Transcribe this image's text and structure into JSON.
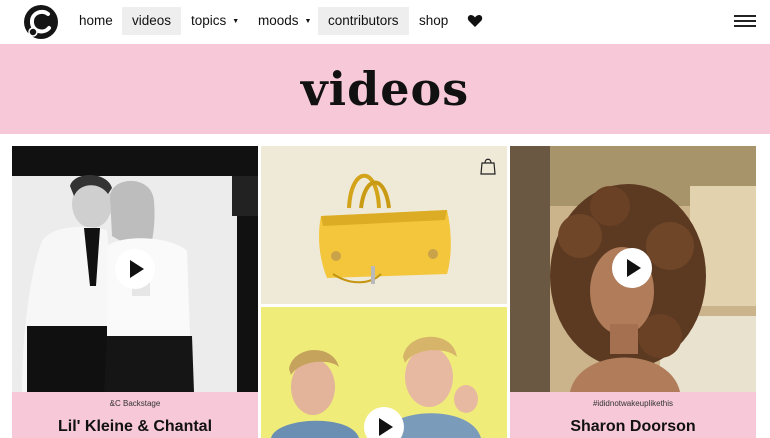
{
  "nav": {
    "items": [
      {
        "label": "home"
      },
      {
        "label": "videos"
      },
      {
        "label": "topics"
      },
      {
        "label": "moods"
      },
      {
        "label": "contributors"
      },
      {
        "label": "shop"
      }
    ],
    "caret": "▼",
    "icons": {
      "logo": "andc-logo",
      "heart": "heart-icon",
      "menu": "hamburger-menu-icon"
    }
  },
  "hero": {
    "title": "videos"
  },
  "cards": [
    {
      "tag": "&C Backstage",
      "title": "Lil' Kleine & Chantal",
      "type": "video"
    },
    {
      "type": "product",
      "icon": "shopping-bag-icon"
    },
    {
      "type": "video"
    },
    {
      "tag": "#ididnotwakeuplikethis",
      "title": "Sharon Doorson",
      "type": "video"
    }
  ],
  "colors": {
    "accent_pink": "#f6c8d8",
    "active_nav": "#eeeeee",
    "text": "#111111"
  }
}
